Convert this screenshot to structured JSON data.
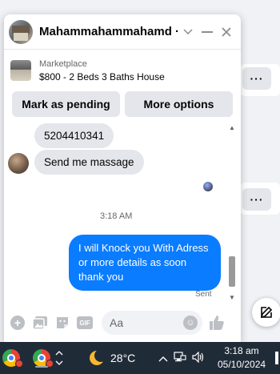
{
  "chat": {
    "contact_name": "Mahammahammahamd · ...",
    "marketplace": {
      "label": "Marketplace",
      "listing": "$800 - 2 Beds 3 Baths House"
    },
    "actions": {
      "mark_pending": "Mark as pending",
      "more_options": "More options"
    },
    "messages": {
      "incoming_1": "5204410341",
      "incoming_2": "Send  me massage",
      "timestamp": "3:18 AM",
      "outgoing_1": "I will Knock you With Adress or more details  as soon thank you",
      "status": "Sent"
    },
    "composer": {
      "placeholder": "Aa",
      "gif_label": "GIF"
    }
  },
  "background": {
    "more_button": "···"
  },
  "taskbar": {
    "temperature": "28°C",
    "time": "3:18 am",
    "date": "05/10/2024"
  },
  "colors": {
    "accent_blue": "#0a7cff",
    "bubble_gray": "#e4e6eb",
    "taskbar": "#202b38"
  }
}
